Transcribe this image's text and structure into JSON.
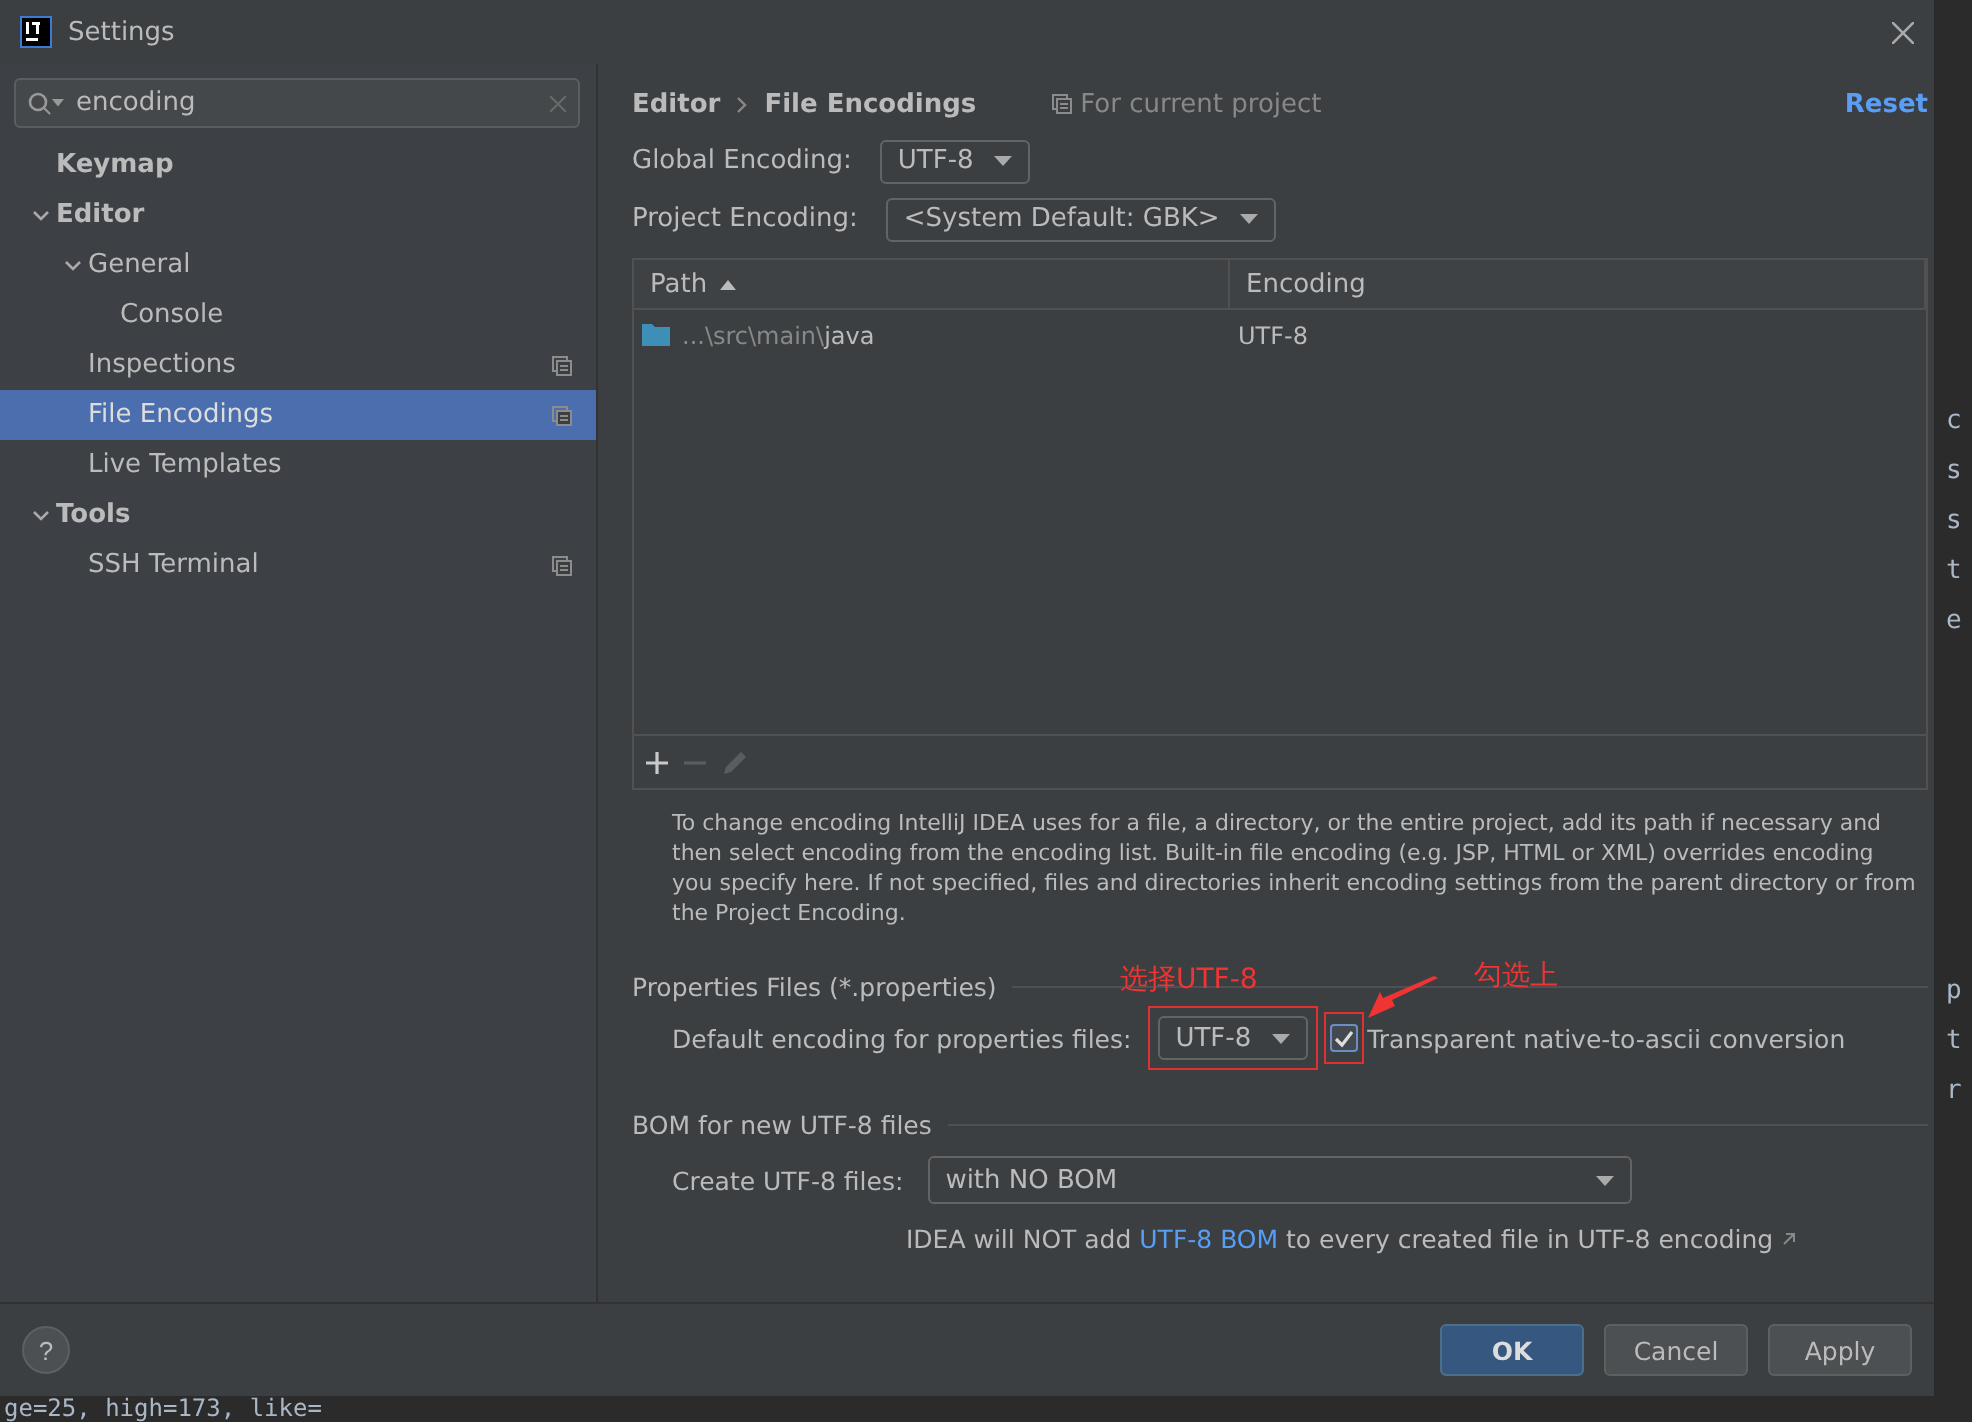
{
  "window": {
    "title": "Settings"
  },
  "search": {
    "value": "encoding"
  },
  "sidebar": {
    "items": [
      {
        "label": "Keymap",
        "selected": false,
        "project_scope": false
      },
      {
        "label": "Editor",
        "selected": false,
        "project_scope": false,
        "expanded": true,
        "children": [
          {
            "label": "General",
            "selected": false,
            "project_scope": false,
            "expanded": true,
            "children": [
              {
                "label": "Console",
                "selected": false,
                "project_scope": false
              }
            ]
          },
          {
            "label": "Inspections",
            "selected": false,
            "project_scope": true
          },
          {
            "label": "File Encodings",
            "selected": true,
            "project_scope": true
          },
          {
            "label": "Live Templates",
            "selected": false,
            "project_scope": false
          }
        ]
      },
      {
        "label": "Tools",
        "selected": false,
        "project_scope": false,
        "expanded": true,
        "children": [
          {
            "label": "SSH Terminal",
            "selected": false,
            "project_scope": true
          }
        ]
      }
    ]
  },
  "breadcrumb": [
    "Editor",
    "File Encodings"
  ],
  "scope_note": "For current project",
  "reset": "Reset",
  "global_encoding": {
    "label": "Global Encoding:",
    "value": "UTF-8"
  },
  "project_encoding": {
    "label": "Project Encoding:",
    "value": "<System Default: GBK>"
  },
  "table": {
    "columns": [
      {
        "label": "Path",
        "sorted": true
      },
      {
        "label": "Encoding",
        "sorted": false
      }
    ],
    "rows": [
      {
        "path_prefix": "...\\src\\main\\",
        "path_name": "java",
        "encoding": "UTF-8",
        "selected": false
      }
    ]
  },
  "toolbar": [
    {
      "kind": "add",
      "disabled": false
    },
    {
      "kind": "remove",
      "disabled": true
    },
    {
      "kind": "edit",
      "disabled": true
    }
  ],
  "description": "To change encoding IntelliJ IDEA uses for a file, a directory, or the entire project, add its path if necessary and then select encoding from the encoding list. Built-in file encoding (e.g. JSP, HTML or XML) overrides encoding you specify here. If not specified, files and directories inherit encoding settings from the parent directory or from the Project Encoding.",
  "properties": {
    "title": "Properties Files (*.properties)",
    "label": "Default encoding for properties files:",
    "value": "UTF-8",
    "checkbox": {
      "label": "Transparent native-to-ascii conversion",
      "checked": true
    }
  },
  "bom": {
    "title": "BOM for new UTF-8 files",
    "label": "Create UTF-8 files:",
    "value": "with NO BOM",
    "note_before": "IDEA will NOT add ",
    "note_link": "UTF-8 BOM",
    "note_after": " to every created file in UTF-8 encoding"
  },
  "annotations": [
    {
      "kind": "dropdown",
      "text": "选择UTF-8"
    },
    {
      "kind": "checkbox",
      "text": "勾选上"
    }
  ],
  "help": "?",
  "buttons": [
    {
      "label": "OK",
      "kind": "primary"
    },
    {
      "label": "Cancel",
      "kind": "normal"
    },
    {
      "label": "Apply",
      "kind": "normal"
    }
  ],
  "background_code": {
    "bottom_line": "ge=25, high=173, like=",
    "right_groups": [
      [
        "c",
        "s",
        "s",
        "t",
        "e"
      ],
      [
        "p",
        "t",
        "r"
      ]
    ]
  }
}
